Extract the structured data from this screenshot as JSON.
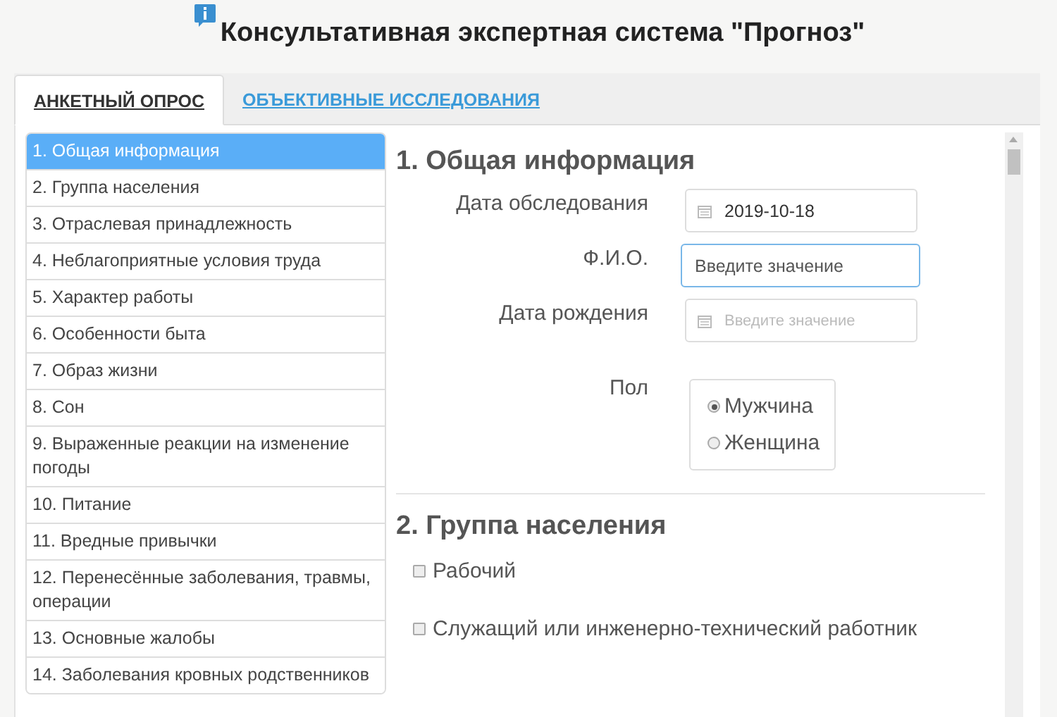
{
  "header": {
    "title": "Консультативная экспертная система \"Прогноз\""
  },
  "tabs": [
    {
      "label": "АНКЕТНЫЙ ОПРОС",
      "selected": true
    },
    {
      "label": "ОБЪЕКТИВНЫЕ ИССЛЕДОВАНИЯ",
      "selected": false
    }
  ],
  "sidebar": {
    "items": [
      {
        "label": "1. Общая информация",
        "selected": true
      },
      {
        "label": "2. Группа населения",
        "selected": false
      },
      {
        "label": "3. Отраслевая принадлежность",
        "selected": false
      },
      {
        "label": "4. Неблагоприятные условия труда",
        "selected": false
      },
      {
        "label": "5. Характер работы",
        "selected": false
      },
      {
        "label": "6. Особенности быта",
        "selected": false
      },
      {
        "label": "7. Образ жизни",
        "selected": false
      },
      {
        "label": "8. Сон",
        "selected": false
      },
      {
        "label": "9. Выраженные реакции на изменение погоды",
        "selected": false
      },
      {
        "label": "10. Питание",
        "selected": false
      },
      {
        "label": "11. Вредные привычки",
        "selected": false
      },
      {
        "label": "12. Перенесённые заболевания, травмы, операции",
        "selected": false
      },
      {
        "label": "13. Основные жалобы",
        "selected": false
      },
      {
        "label": "14. Заболевания кровных родственников",
        "selected": false
      }
    ]
  },
  "form": {
    "sections": [
      {
        "title": "1. Общая информация",
        "kind": "fields",
        "fields": [
          {
            "kind": "date",
            "label": "Дата обследования",
            "value": "2019-10-18"
          },
          {
            "kind": "text",
            "label": "Ф.И.О.",
            "placeholder": "Введите значение",
            "focused": true
          },
          {
            "kind": "date",
            "label": "Дата рождения",
            "placeholder": "Введите значение"
          },
          {
            "kind": "radio",
            "label": "Пол",
            "options": [
              {
                "label": "Мужчина",
                "selected": true
              },
              {
                "label": "Женщина",
                "selected": false
              }
            ]
          }
        ]
      },
      {
        "title": "2. Группа населения",
        "kind": "checks",
        "options": [
          {
            "label": "Рабочий",
            "checked": false
          },
          {
            "label": "Служащий или инженерно-технический работник",
            "checked": false
          }
        ]
      }
    ]
  }
}
